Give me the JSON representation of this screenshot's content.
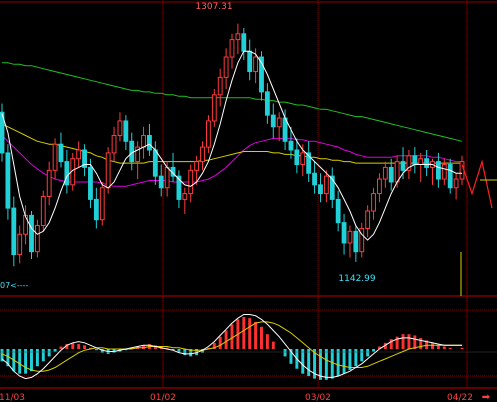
{
  "chart_data": {
    "type": "candlestick",
    "x_ticks": [
      "11/03",
      "01/02",
      "03/02",
      "04/22"
    ],
    "annotations": {
      "high_label": "1307.31",
      "low_label": "1142.99",
      "left_edge_label": "07<----",
      "nav_arrow": "➡"
    },
    "grid": true,
    "colors": {
      "background": "#000000",
      "grid": "#8a0000",
      "up_candle": "#ff3b3b",
      "down_candle": "#22d0d8",
      "ma_white": "#ffffff",
      "ma_yellow": "#d8d000",
      "ma_magenta": "#e000e0",
      "ma_green": "#20c020",
      "macd_pos": "#ff3030",
      "macd_neg": "#20d0d8",
      "forecast": "#ff2020",
      "date_labels": "#ff4040",
      "price_labels": "#ff6060",
      "low_label": "#40e0f0"
    },
    "price_range": [
      1125,
      1315
    ],
    "macd_range": [
      -30,
      30
    ],
    "candles": [
      [
        1246,
        1252,
        1212,
        1218
      ],
      [
        1218,
        1224,
        1172,
        1180
      ],
      [
        1180,
        1188,
        1140,
        1148
      ],
      [
        1148,
        1168,
        1142,
        1162
      ],
      [
        1162,
        1182,
        1155,
        1175
      ],
      [
        1175,
        1178,
        1145,
        1150
      ],
      [
        1150,
        1172,
        1146,
        1168
      ],
      [
        1168,
        1192,
        1164,
        1188
      ],
      [
        1188,
        1212,
        1182,
        1206
      ],
      [
        1206,
        1228,
        1200,
        1224
      ],
      [
        1224,
        1232,
        1208,
        1212
      ],
      [
        1212,
        1220,
        1190,
        1196
      ],
      [
        1196,
        1218,
        1192,
        1214
      ],
      [
        1214,
        1226,
        1208,
        1220
      ],
      [
        1220,
        1224,
        1202,
        1208
      ],
      [
        1208,
        1214,
        1180,
        1186
      ],
      [
        1186,
        1194,
        1166,
        1172
      ],
      [
        1172,
        1198,
        1168,
        1194
      ],
      [
        1194,
        1222,
        1190,
        1218
      ],
      [
        1218,
        1236,
        1212,
        1230
      ],
      [
        1230,
        1246,
        1226,
        1240
      ],
      [
        1240,
        1244,
        1220,
        1226
      ],
      [
        1226,
        1232,
        1206,
        1212
      ],
      [
        1212,
        1226,
        1200,
        1222
      ],
      [
        1222,
        1236,
        1214,
        1230
      ],
      [
        1230,
        1238,
        1216,
        1220
      ],
      [
        1220,
        1226,
        1196,
        1202
      ],
      [
        1202,
        1210,
        1188,
        1194
      ],
      [
        1194,
        1212,
        1188,
        1208
      ],
      [
        1208,
        1218,
        1198,
        1202
      ],
      [
        1202,
        1206,
        1180,
        1186
      ],
      [
        1186,
        1194,
        1176,
        1190
      ],
      [
        1190,
        1210,
        1184,
        1206
      ],
      [
        1206,
        1216,
        1196,
        1212
      ],
      [
        1212,
        1226,
        1206,
        1222
      ],
      [
        1222,
        1244,
        1218,
        1240
      ],
      [
        1240,
        1262,
        1236,
        1258
      ],
      [
        1258,
        1276,
        1250,
        1270
      ],
      [
        1270,
        1290,
        1262,
        1284
      ],
      [
        1284,
        1300,
        1276,
        1296
      ],
      [
        1296,
        1307,
        1286,
        1300
      ],
      [
        1300,
        1304,
        1282,
        1288
      ],
      [
        1288,
        1296,
        1268,
        1274
      ],
      [
        1274,
        1290,
        1266,
        1284
      ],
      [
        1284,
        1288,
        1254,
        1260
      ],
      [
        1260,
        1266,
        1238,
        1244
      ],
      [
        1244,
        1252,
        1228,
        1236
      ],
      [
        1236,
        1246,
        1226,
        1242
      ],
      [
        1242,
        1248,
        1220,
        1226
      ],
      [
        1226,
        1236,
        1214,
        1220
      ],
      [
        1220,
        1228,
        1204,
        1210
      ],
      [
        1210,
        1224,
        1202,
        1218
      ],
      [
        1218,
        1226,
        1198,
        1204
      ],
      [
        1204,
        1212,
        1190,
        1196
      ],
      [
        1196,
        1204,
        1184,
        1190
      ],
      [
        1190,
        1206,
        1184,
        1202
      ],
      [
        1202,
        1208,
        1180,
        1186
      ],
      [
        1186,
        1192,
        1164,
        1170
      ],
      [
        1170,
        1176,
        1148,
        1156
      ],
      [
        1156,
        1168,
        1146,
        1164
      ],
      [
        1164,
        1168,
        1143,
        1150
      ],
      [
        1150,
        1170,
        1146,
        1166
      ],
      [
        1166,
        1182,
        1160,
        1178
      ],
      [
        1178,
        1194,
        1172,
        1190
      ],
      [
        1190,
        1204,
        1184,
        1200
      ],
      [
        1200,
        1212,
        1194,
        1208
      ],
      [
        1208,
        1214,
        1192,
        1198
      ],
      [
        1198,
        1216,
        1194,
        1212
      ],
      [
        1212,
        1222,
        1200,
        1206
      ],
      [
        1206,
        1220,
        1200,
        1216
      ],
      [
        1216,
        1222,
        1204,
        1210
      ],
      [
        1210,
        1218,
        1198,
        1214
      ],
      [
        1214,
        1220,
        1202,
        1208
      ],
      [
        1208,
        1214,
        1196,
        1212
      ],
      [
        1212,
        1218,
        1194,
        1200
      ],
      [
        1200,
        1214,
        1196,
        1210
      ],
      [
        1210,
        1214,
        1190,
        1194
      ],
      [
        1194,
        1204,
        1186,
        1200
      ],
      [
        1200,
        1216,
        1196,
        1212
      ]
    ],
    "ma_white": [
      1245,
      1232,
      1210,
      1188,
      1174,
      1166,
      1162,
      1164,
      1170,
      1180,
      1192,
      1202,
      1206,
      1208,
      1210,
      1210,
      1204,
      1196,
      1194,
      1198,
      1206,
      1214,
      1218,
      1220,
      1222,
      1224,
      1220,
      1214,
      1208,
      1204,
      1200,
      1196,
      1195,
      1198,
      1204,
      1212,
      1224,
      1238,
      1254,
      1268,
      1280,
      1288,
      1288,
      1286,
      1280,
      1272,
      1262,
      1252,
      1242,
      1234,
      1226,
      1220,
      1216,
      1212,
      1208,
      1204,
      1200,
      1194,
      1186,
      1178,
      1168,
      1162,
      1158,
      1162,
      1170,
      1180,
      1190,
      1198,
      1204,
      1208,
      1210,
      1210,
      1210,
      1210,
      1208,
      1207,
      1206,
      1204,
      1204
    ],
    "ma_yellow": [
      1238,
      1236,
      1234,
      1232,
      1230,
      1228,
      1226,
      1225,
      1224,
      1224,
      1223,
      1222,
      1221,
      1220,
      1219,
      1218,
      1216,
      1215,
      1213,
      1212,
      1211,
      1211,
      1211,
      1211,
      1211,
      1212,
      1212,
      1212,
      1212,
      1212,
      1212,
      1212,
      1212,
      1212,
      1213,
      1213,
      1214,
      1215,
      1216,
      1217,
      1218,
      1219,
      1219,
      1219,
      1219,
      1219,
      1218,
      1218,
      1217,
      1217,
      1216,
      1216,
      1215,
      1215,
      1214,
      1214,
      1213,
      1213,
      1212,
      1212,
      1211,
      1211,
      1211,
      1211,
      1211,
      1211,
      1211,
      1211,
      1211,
      1211,
      1211,
      1211,
      1211,
      1211,
      1211,
      1211,
      1211,
      1211,
      1211
    ],
    "ma_magenta": [
      1230,
      1226,
      1222,
      1218,
      1214,
      1210,
      1207,
      1204,
      1202,
      1200,
      1199,
      1198,
      1198,
      1198,
      1198,
      1198,
      1198,
      1197,
      1196,
      1195,
      1195,
      1195,
      1196,
      1197,
      1198,
      1199,
      1199,
      1199,
      1199,
      1198,
      1198,
      1198,
      1198,
      1198,
      1199,
      1200,
      1202,
      1205,
      1208,
      1212,
      1216,
      1220,
      1223,
      1225,
      1226,
      1227,
      1228,
      1228,
      1228,
      1228,
      1227,
      1227,
      1226,
      1226,
      1225,
      1224,
      1223,
      1222,
      1220,
      1219,
      1217,
      1216,
      1215,
      1215,
      1215,
      1215,
      1215,
      1216,
      1216,
      1216,
      1216,
      1216,
      1216,
      1215,
      1215,
      1214,
      1213,
      1212,
      1212
    ],
    "ma_green": [
      1280,
      1280,
      1279,
      1279,
      1278,
      1278,
      1277,
      1276,
      1275,
      1274,
      1273,
      1272,
      1271,
      1270,
      1269,
      1268,
      1267,
      1266,
      1265,
      1264,
      1263,
      1262,
      1261,
      1261,
      1260,
      1260,
      1259,
      1259,
      1258,
      1258,
      1257,
      1257,
      1256,
      1256,
      1256,
      1256,
      1256,
      1256,
      1256,
      1256,
      1256,
      1256,
      1256,
      1255,
      1255,
      1254,
      1254,
      1253,
      1253,
      1252,
      1251,
      1251,
      1250,
      1249,
      1248,
      1248,
      1247,
      1246,
      1245,
      1244,
      1243,
      1243,
      1242,
      1241,
      1240,
      1239,
      1238,
      1237,
      1236,
      1235,
      1234,
      1233,
      1232,
      1231,
      1230,
      1229,
      1228,
      1227,
      1226
    ],
    "macd_hist": [
      -10,
      -14,
      -18,
      -20,
      -20,
      -18,
      -14,
      -10,
      -6,
      -2,
      2,
      4,
      5,
      4,
      3,
      1,
      -1,
      -3,
      -4,
      -3,
      -2,
      -1,
      1,
      2,
      3,
      4,
      3,
      2,
      1,
      -1,
      -3,
      -5,
      -6,
      -5,
      -3,
      1,
      5,
      10,
      15,
      20,
      24,
      26,
      25,
      22,
      18,
      12,
      6,
      0,
      -6,
      -12,
      -16,
      -20,
      -22,
      -24,
      -25,
      -25,
      -24,
      -22,
      -20,
      -17,
      -14,
      -10,
      -6,
      -2,
      2,
      5,
      8,
      10,
      12,
      12,
      11,
      9,
      7,
      5,
      3,
      2,
      1,
      0,
      1
    ],
    "macd_dif": [
      -8,
      -12,
      -18,
      -22,
      -24,
      -23,
      -20,
      -16,
      -11,
      -6,
      -1,
      3,
      5,
      6,
      5,
      3,
      1,
      -1,
      -2,
      -2,
      -1,
      0,
      1,
      2,
      3,
      3,
      2,
      1,
      0,
      -1,
      -3,
      -4,
      -4,
      -3,
      -1,
      2,
      6,
      11,
      16,
      21,
      25,
      28,
      28,
      27,
      24,
      20,
      15,
      10,
      4,
      -2,
      -8,
      -13,
      -17,
      -20,
      -22,
      -23,
      -23,
      -22,
      -20,
      -18,
      -15,
      -12,
      -8,
      -4,
      0,
      3,
      6,
      8,
      9,
      9,
      8,
      7,
      6,
      5,
      4,
      3,
      3,
      3,
      3
    ],
    "macd_dea": [
      -4,
      -6,
      -9,
      -12,
      -15,
      -17,
      -18,
      -18,
      -17,
      -15,
      -12,
      -9,
      -6,
      -3,
      -1,
      0,
      1,
      1,
      0,
      0,
      0,
      0,
      0,
      1,
      1,
      2,
      2,
      2,
      2,
      1,
      1,
      0,
      -1,
      -1,
      -1,
      0,
      1,
      3,
      6,
      9,
      12,
      15,
      18,
      21,
      22,
      22,
      21,
      19,
      16,
      13,
      9,
      5,
      1,
      -3,
      -6,
      -9,
      -11,
      -13,
      -14,
      -15,
      -15,
      -15,
      -14,
      -12,
      -10,
      -8,
      -6,
      -4,
      -2,
      0,
      1,
      2,
      3,
      3,
      3,
      3,
      3,
      3,
      3
    ],
    "forecast": [
      1210,
      1190,
      1212,
      1180
    ]
  }
}
